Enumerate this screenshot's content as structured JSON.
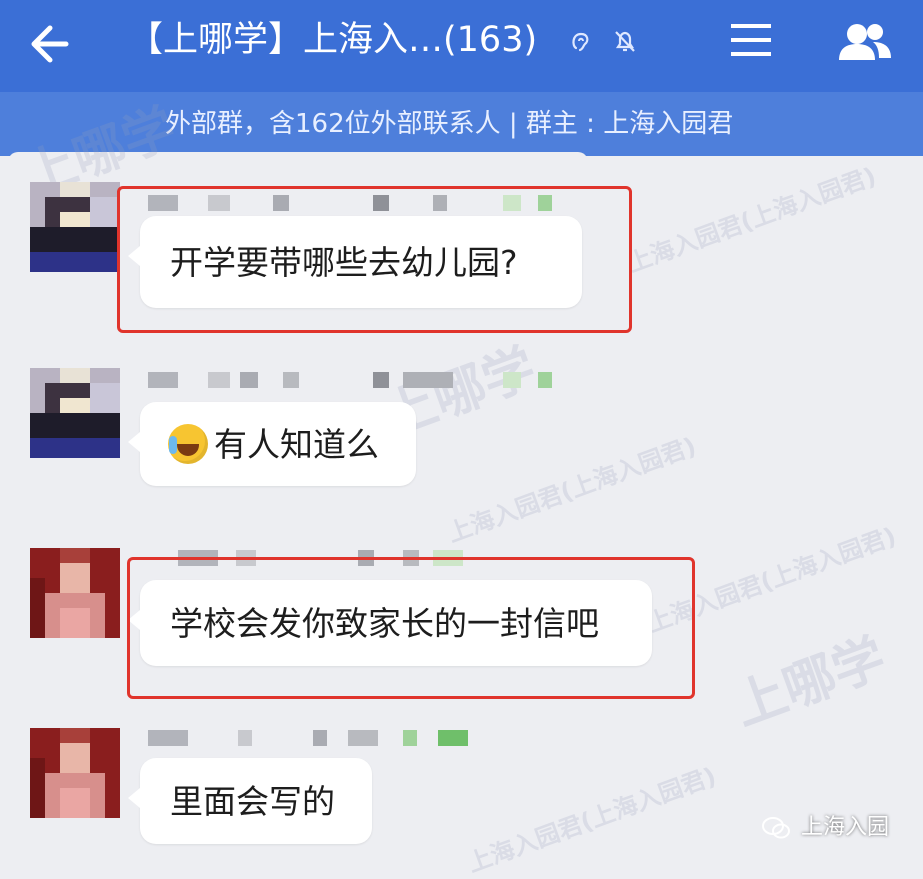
{
  "header": {
    "title": "【上哪学】上海入…(163)",
    "back_icon": "back-arrow-icon",
    "menu_icon": "menu-icon",
    "members_icon": "group-members-icon"
  },
  "subheader": {
    "text": "外部群，含162位外部联系人 | 群主 : 上海入园君"
  },
  "messages": [
    {
      "text": "开学要带哪些去幼儿园?",
      "highlighted": true,
      "avatar": "avatar-1"
    },
    {
      "text": "有人知道么",
      "emoji": "crying-laughing-emoji-icon",
      "highlighted": false,
      "avatar": "avatar-1"
    },
    {
      "text": "学校会发你致家长的一封信吧",
      "highlighted": true,
      "avatar": "avatar-2"
    },
    {
      "text": "里面会写的",
      "highlighted": false,
      "avatar": "avatar-2"
    }
  ],
  "watermarks": {
    "logo_text": "上哪学",
    "diagonal_text": "上海入园君(上海入园君)"
  },
  "source_tag": {
    "text": "上海入园",
    "icon": "wechat-icon"
  },
  "colors": {
    "header_bg": "#3b6fd6",
    "subheader_bg": "#4e7fdb",
    "chat_bg": "#edeef2",
    "highlight_border": "#e0342c"
  }
}
